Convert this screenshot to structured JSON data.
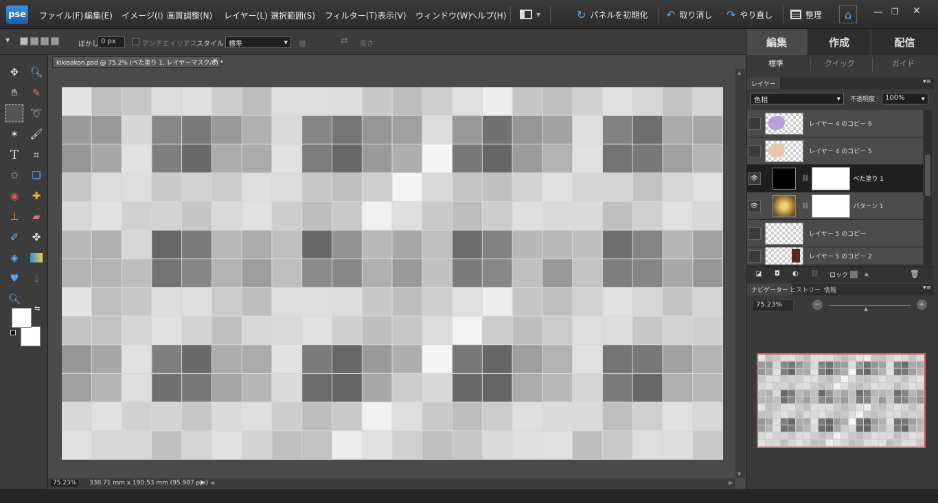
{
  "app": {
    "logo": "pse"
  },
  "menu": [
    "ファイル(F)",
    "編集(E)",
    "イメージ(I)",
    "画質調整(N)",
    "レイヤー(L)",
    "選択範囲(S)",
    "フィルター(T)",
    "表示(V)",
    "ウィンドウ(W)",
    "ヘルプ(H)"
  ],
  "toolbar_right": {
    "reset_panels": "パネルを初期化",
    "undo": "取り消し",
    "redo": "やり直し",
    "organize": "整理"
  },
  "options": {
    "blur_label": "ぼかし :",
    "blur_value": "0 px",
    "antialias": "アンチエイリアス",
    "style_label": "スタイル :",
    "style_value": "標準",
    "width_label": "幅",
    "height_label": "高さ"
  },
  "document": {
    "tab_title": "kikisakon.psd @ 75.2% (べた塗り 1, レイヤーマスク/8) *",
    "zoom": "75.23%",
    "size_info": "338.71 mm x 190.53 mm (95.987 ppi)"
  },
  "panel_tabs": [
    "編集",
    "作成",
    "配信"
  ],
  "sub_tabs": [
    "標準",
    "クイック",
    "ガイド"
  ],
  "layers_panel": {
    "title": "レイヤー",
    "blend_mode": "色相",
    "opacity_label": "不透明度 :",
    "opacity_value": "100%",
    "lock_label": "ロック :",
    "layers": [
      {
        "name": "レイヤー 4 のコピー 6",
        "visible": false
      },
      {
        "name": "レイヤー 4 のコピー 5",
        "visible": false
      },
      {
        "name": "べた塗り 1",
        "visible": true,
        "selected": true
      },
      {
        "name": "パターン 1",
        "visible": true
      },
      {
        "name": "レイヤー 5 のコピー",
        "visible": false
      },
      {
        "name": "レイヤー 5 のコピー 2",
        "visible": false
      }
    ]
  },
  "navigator_panel": {
    "tabs": [
      "ナビゲーター",
      "ヒストリー",
      "情報"
    ],
    "zoom_value": "75.23%"
  },
  "colors": {
    "accent": "#3b8fe0",
    "navigator_frame": "#e05a5a"
  }
}
